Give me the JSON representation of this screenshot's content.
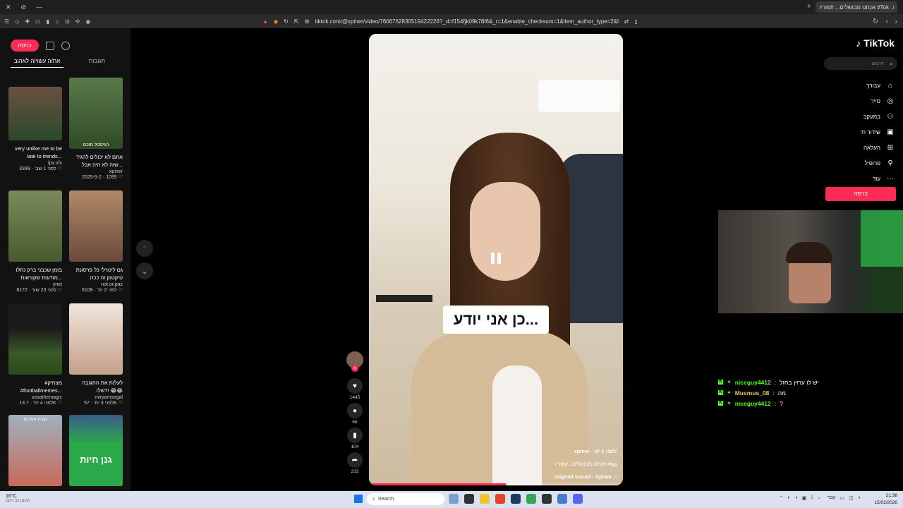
{
  "browser": {
    "url": "tiktok.com/@xpiner/video/7606762830519422226?_d=f154fjk09k78f6&_r=1&enable_checksum=1&item_author_type=2&link_reflow...",
    "tab_title": "אנחנו מבושלים... #פוריו #Tok",
    "new_tab": "+"
  },
  "left_panel": {
    "login_label": "כניסה",
    "tabs": [
      {
        "label": "תגובות"
      },
      {
        "label": "את/ה עשוי/ה לאהוב"
      }
    ],
    "cards": [
      {
        "title": "אתם לא יכולים להגיד שזה לא היה אבל...",
        "caption": "הגיסטל מוכם",
        "author": "xpiner",
        "meta": "2025-5-2 · 1095 ♡",
        "thumb_color": "#4a6a3f"
      },
      {
        "title": "very unlike me to be late to trends...",
        "caption": "",
        "author": "lpx.vfx",
        "meta": "לפני 1 שב' · 3399 ♡",
        "thumb_color": "#5a4030"
      },
      {
        "title": "גם ליטרלי כל פרסונת טיקטוק זה ככה",
        "caption": "",
        "author": "not.or.paz",
        "meta": "לפני 2 ימ' · 6108 ♡",
        "thumb_color": "#8a6a50"
      },
      {
        "title": "בזמן שכבני ברק נתלו מודעות שקוראות...",
        "caption": "",
        "author": "ynet",
        "meta": "לפני 23 שע' · 8172 ♡",
        "thumb_color": "#5c6a3c"
      },
      {
        "title": "לעלות את התגובה שלו?! 😂😂",
        "caption": "",
        "author": "miryamsegal",
        "meta": "לפני 3 ימ' · 57K ♡",
        "thumb_color": "#d9c4b0"
      },
      {
        "title": "#מצחיק #footballmemes...",
        "caption": "",
        "author": "sosathemagic",
        "meta": "לפני 4 ימ' · 13.7K ♡",
        "thumb_color": "#3b4a2a"
      },
      {
        "title": "",
        "caption": "גנן חיות",
        "author": "",
        "meta": "",
        "thumb_color": "#2aa84a"
      },
      {
        "title": "",
        "caption": "שבת אחרים",
        "author": "",
        "meta": "",
        "thumb_color": "#c86a5a"
      }
    ]
  },
  "video": {
    "caption": "כן אני יודע...",
    "author": "xpiner · לפני 1 ימ'",
    "description": "אנחנו מבושלים...#פוריו #fyp",
    "sound": "original sound - Xpiner ♫",
    "progress": 0.54
  },
  "actions": {
    "likes": "1445",
    "comments": "66",
    "saves": "104",
    "shares": "233"
  },
  "right_nav": {
    "logo": "TikTok",
    "search_placeholder": "חיפוש",
    "items": [
      {
        "label": "עבורך",
        "icon": "home-icon",
        "glyph": "⌂"
      },
      {
        "label": "סייר",
        "icon": "compass-icon",
        "glyph": "◎"
      },
      {
        "label": "במעקב",
        "icon": "following-icon",
        "glyph": "⚇"
      },
      {
        "label": "שידור חי",
        "icon": "live-icon",
        "glyph": "▣"
      },
      {
        "label": "העלאה",
        "icon": "upload-icon",
        "glyph": "⊞"
      },
      {
        "label": "פרופיל",
        "icon": "profile-icon",
        "glyph": "⚲"
      },
      {
        "label": "עוד",
        "icon": "more-icon",
        "glyph": "···"
      }
    ],
    "login_label": "כניסה"
  },
  "chat": {
    "messages": [
      {
        "user": "niceguy4412",
        "text": "יש לו ערוץ בחול",
        "color": "#53fc18"
      },
      {
        "user": "Musmus_08",
        "text": "מה",
        "color": "#e6c84a"
      },
      {
        "user": "niceguy4412",
        "text": "?",
        "color": "#53fc18"
      }
    ]
  },
  "taskbar": {
    "temp": "16°C",
    "weather_desc": "מעונן רב היום",
    "search_label": "Search",
    "clock_time": "21:38",
    "clock_date": "15/02/2026",
    "lang": "עבר"
  }
}
